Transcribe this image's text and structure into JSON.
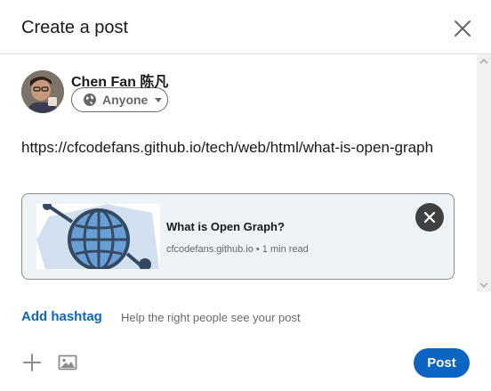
{
  "dialog": {
    "title": "Create a post",
    "close_icon": "close-icon"
  },
  "author": {
    "name": "Chen Fan 陈凡",
    "visibility": "Anyone",
    "visibility_icon": "globe-icon"
  },
  "post": {
    "text": "https://cfcodefans.github.io/tech/web/html/what-is-open-graph"
  },
  "link_preview": {
    "title": "What is Open Graph?",
    "meta": "cfcodefans.github.io • 1 min read",
    "thumbnail_icon": "open-graph-logo",
    "close_icon": "close-icon"
  },
  "hashtag": {
    "label": "Add hashtag",
    "hint": "Help the right people see your post"
  },
  "footer": {
    "add_icon": "plus-icon",
    "image_icon": "image-icon",
    "post_label": "Post"
  },
  "colors": {
    "accent": "#0a66c2",
    "preview_bg": "#eef3f8",
    "dark_button": "#404040"
  }
}
